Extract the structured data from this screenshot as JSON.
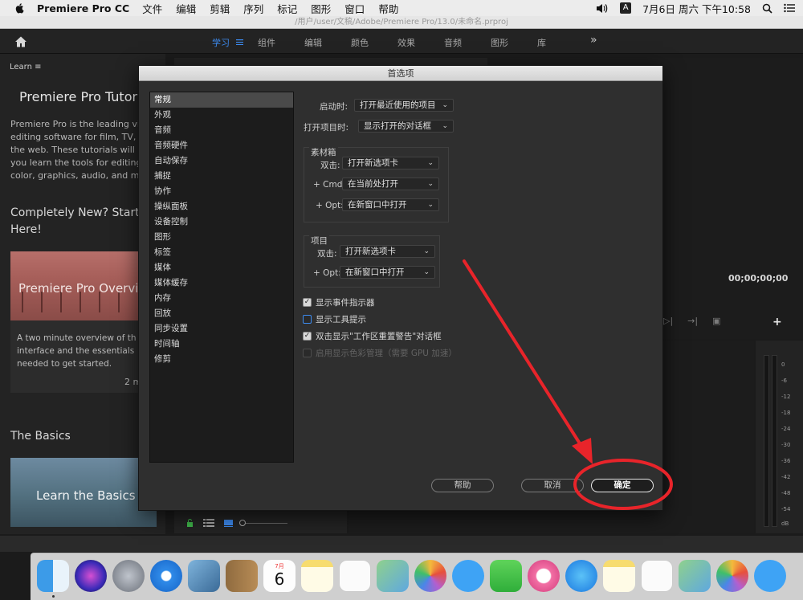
{
  "menubar": {
    "app_name": "Premiere Pro CC",
    "items": [
      "文件",
      "编辑",
      "剪辑",
      "序列",
      "标记",
      "图形",
      "窗口",
      "帮助"
    ],
    "input_indicator": "A",
    "clock": "7月6日 周六 下午10:58"
  },
  "window": {
    "path": "/用户/user/文稿/Adobe/Premiere Pro/13.0/未命名.prproj"
  },
  "workspaces": {
    "tabs": [
      "学习",
      "组件",
      "编辑",
      "颜色",
      "效果",
      "音频",
      "图形",
      "库"
    ],
    "active": "学习",
    "more": "»"
  },
  "learn": {
    "header": "Learn",
    "title": "Premiere Pro Tutorial",
    "description": [
      "Premiere Pro is the leading vid",
      "editing software for film, TV, an",
      "the web. These tutorials will he",
      "you learn the tools for editing,",
      "color, graphics, audio, and mor"
    ],
    "section1": "Completely New? Start Here!",
    "card1_title": "Premiere Pro Overvi",
    "card1_text": [
      "A two minute overview of th",
      "interface and the essentials",
      "needed to get started."
    ],
    "card1_duration": "2 m",
    "section2": "The Basics",
    "card2_title": "Learn the Basics"
  },
  "program": {
    "timecode": "00;00;00;00",
    "add": "+"
  },
  "meter": {
    "ticks": [
      "0",
      "-6",
      "-12",
      "-18",
      "-24",
      "-30",
      "-36",
      "-42",
      "-48",
      "-54",
      "dB"
    ]
  },
  "dialog": {
    "title": "首选项",
    "categories": [
      "常规",
      "外观",
      "音频",
      "音频硬件",
      "自动保存",
      "捕捉",
      "协作",
      "操纵面板",
      "设备控制",
      "图形",
      "标签",
      "媒体",
      "媒体缓存",
      "内存",
      "回放",
      "同步设置",
      "时间轴",
      "修剪"
    ],
    "selected_category": "常规",
    "startup_label": "启动时:",
    "startup_value": "打开最近使用的项目",
    "open_project_label": "打开项目时:",
    "open_project_value": "显示打开的对话框",
    "bin_group": {
      "title": "素材箱",
      "rows": [
        {
          "label": "双击:",
          "value": "打开新选项卡"
        },
        {
          "label": "+ Cmd:",
          "value": "在当前处打开"
        },
        {
          "label": "+ Opt:",
          "value": "在新窗口中打开"
        }
      ]
    },
    "project_group": {
      "title": "项目",
      "rows": [
        {
          "label": "双击:",
          "value": "打开新选项卡"
        },
        {
          "label": "+ Opt:",
          "value": "在新窗口中打开"
        }
      ]
    },
    "checkboxes": [
      {
        "label": "显示事件指示器",
        "checked": true,
        "disabled": false
      },
      {
        "label": "显示工具提示",
        "checked": false,
        "disabled": false
      },
      {
        "label": "双击显示\"工作区重置警告\"对话框",
        "checked": true,
        "disabled": false
      },
      {
        "label": "启用显示色彩管理（需要 GPU 加速）",
        "checked": false,
        "disabled": true
      }
    ],
    "buttons": {
      "help": "帮助",
      "cancel": "取消",
      "ok": "确定"
    }
  },
  "dock_apps": [
    "finder-icon",
    "siri-icon",
    "launchpad-icon",
    "safari-icon",
    "preview-icon",
    "contacts-icon",
    "calendar-icon",
    "notes-icon",
    "reminders-icon",
    "maps-icon",
    "photos-icon",
    "messages-icon",
    "facetime-icon",
    "music-icon",
    "app-store-icon",
    "notes-icon",
    "reminders-icon",
    "maps-icon",
    "photos-icon",
    "messages-icon"
  ],
  "dock_calendar": {
    "month": "7月",
    "day": "6"
  },
  "colors": {
    "accent": "#3d8bf0",
    "annotation": "#e8242a",
    "dialog_bg": "#2f2f2f"
  }
}
